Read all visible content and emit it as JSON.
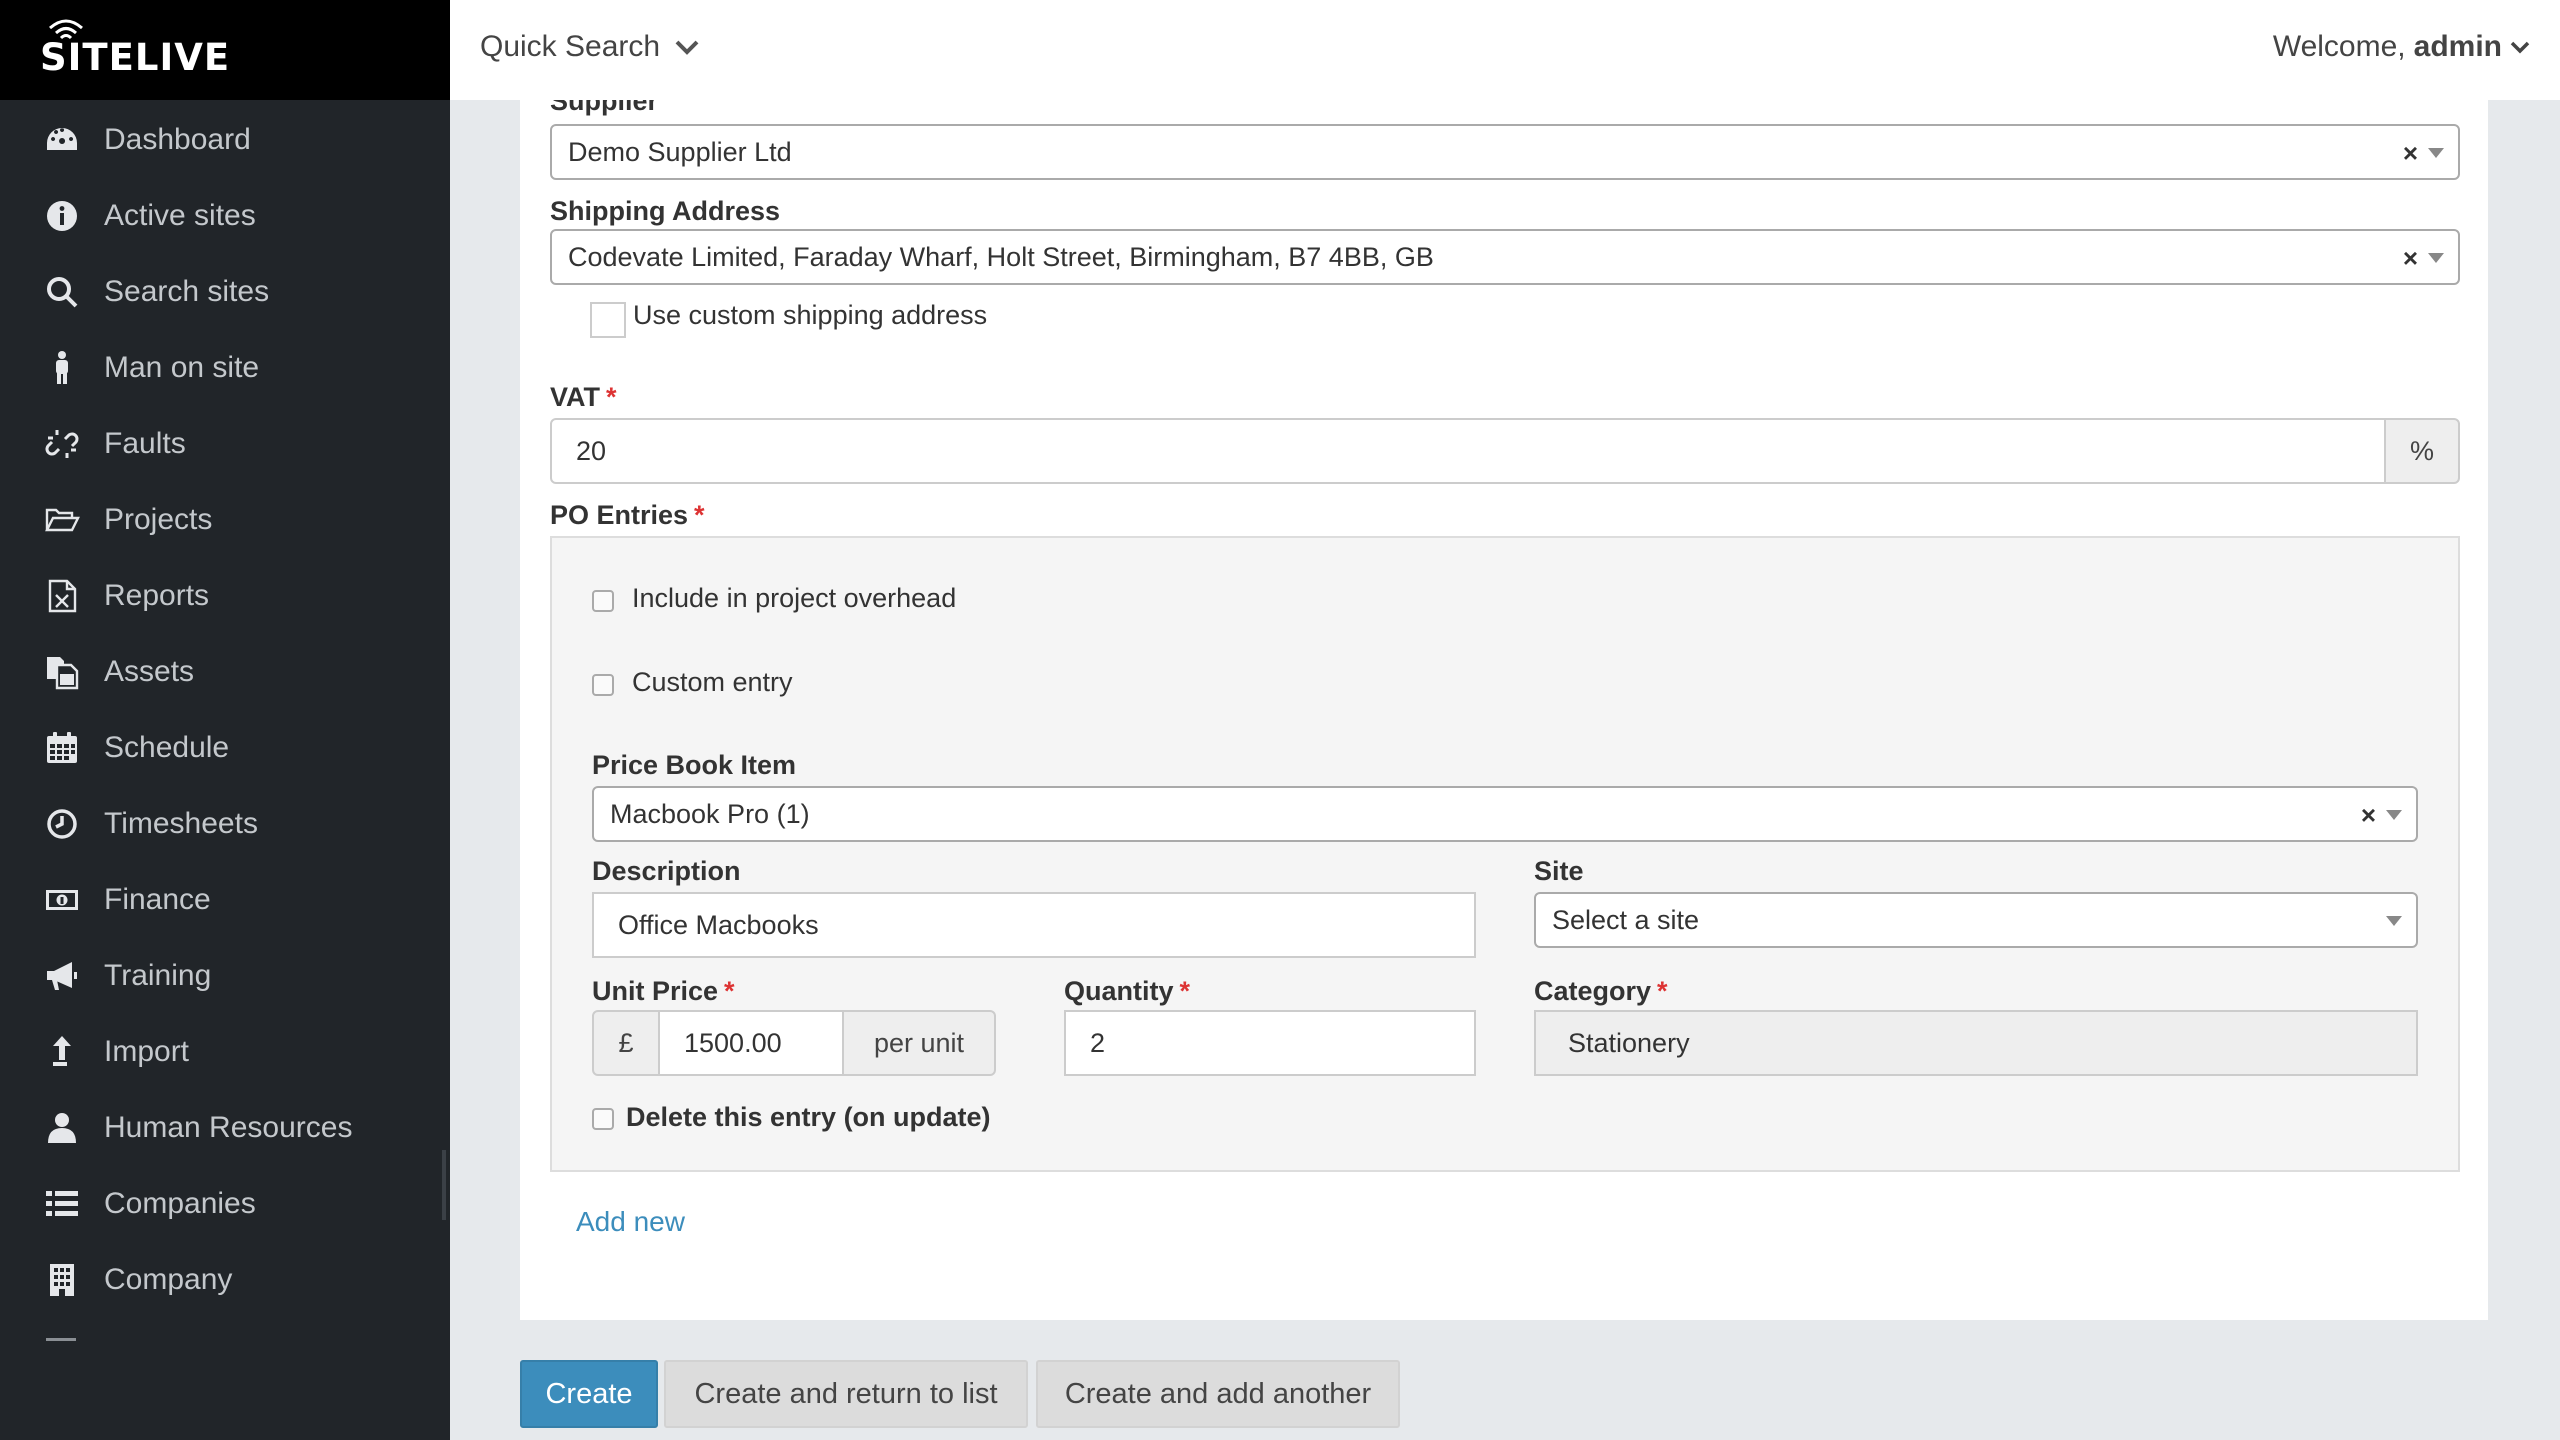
{
  "brand": {
    "name": "SITELIVE"
  },
  "sidebar": {
    "items": [
      {
        "label": "Dashboard",
        "icon": "dashboard-icon"
      },
      {
        "label": "Active sites",
        "icon": "info-icon"
      },
      {
        "label": "Search sites",
        "icon": "search-icon"
      },
      {
        "label": "Man on site",
        "icon": "person-icon"
      },
      {
        "label": "Faults",
        "icon": "broken-link-icon"
      },
      {
        "label": "Projects",
        "icon": "folder-open-icon"
      },
      {
        "label": "Reports",
        "icon": "excel-file-icon"
      },
      {
        "label": "Assets",
        "icon": "copy-icon"
      },
      {
        "label": "Schedule",
        "icon": "calendar-icon"
      },
      {
        "label": "Timesheets",
        "icon": "clock-icon"
      },
      {
        "label": "Finance",
        "icon": "money-icon"
      },
      {
        "label": "Training",
        "icon": "bullhorn-icon"
      },
      {
        "label": "Import",
        "icon": "upload-arrow-icon"
      },
      {
        "label": "Human Resources",
        "icon": "user-icon"
      },
      {
        "label": "Companies",
        "icon": "list-icon"
      },
      {
        "label": "Company",
        "icon": "building-icon"
      }
    ]
  },
  "topbar": {
    "quick_search": "Quick Search",
    "welcome": "Welcome,",
    "username": "admin"
  },
  "form": {
    "supplier_label": "Supplier",
    "supplier_value": "Demo Supplier Ltd",
    "shipping_label": "Shipping Address",
    "shipping_value": "Codevate Limited, Faraday Wharf, Holt Street, Birmingham, B7 4BB, GB",
    "custom_shipping_label": "Use custom shipping address",
    "vat_label": "VAT",
    "vat_value": "20",
    "vat_addon": "%",
    "required_mark": "*",
    "clear_mark": "×",
    "po_entries_label": "PO Entries",
    "entry": {
      "overhead_label": "Include in project overhead",
      "custom_entry_label": "Custom entry",
      "price_book_label": "Price Book Item",
      "price_book_value": "Macbook Pro (1)",
      "description_label": "Description",
      "description_value": "Office Macbooks",
      "site_label": "Site",
      "site_placeholder": "Select a site",
      "unit_price_label": "Unit Price",
      "currency": "£",
      "unit_price_value": "1500.00",
      "per_unit": "per unit",
      "quantity_label": "Quantity",
      "quantity_value": "2",
      "category_label": "Category",
      "category_value": "Stationery",
      "delete_label": "Delete this entry (on update)"
    },
    "add_new": "Add new"
  },
  "actions": {
    "create": "Create",
    "create_return": "Create and return to list",
    "create_another": "Create and add another"
  },
  "colors": {
    "primary": "#3c8dbc",
    "sidebar_bg": "#212529",
    "required": "#dd3333"
  }
}
